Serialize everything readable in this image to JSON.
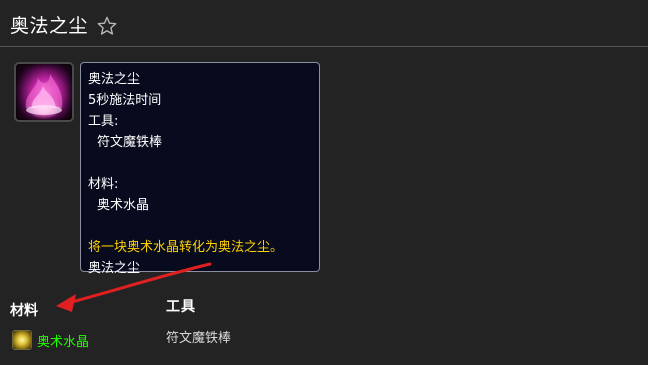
{
  "page": {
    "title": "奥法之尘",
    "favorite_icon": "star-outline-icon"
  },
  "spell": {
    "icon": "arcane-dust-spell-icon",
    "tooltip": {
      "name": "奥法之尘",
      "cast_time": "5秒施法时间",
      "tools_label": "工具:",
      "tool": "符文魔铁棒",
      "reagents_label": "材料:",
      "reagent": "奥术水晶",
      "description": "将一块奥术水晶转化为奥法之尘。",
      "creates": "奥法之尘"
    }
  },
  "materials": {
    "heading": "材料",
    "items": [
      {
        "name": "奥术水晶",
        "icon": "arcane-crystal-icon",
        "quality_color": "#1eff00"
      }
    ]
  },
  "tools": {
    "heading": "工具",
    "items": [
      {
        "name": "符文魔铁棒"
      }
    ]
  },
  "annotation": {
    "icon": "red-arrow-icon",
    "color": "#e02020"
  },
  "colors": {
    "background": "#232323",
    "tooltip_background": "#070b1d",
    "description_gold": "#ffd100",
    "uncommon_green": "#1eff00"
  }
}
